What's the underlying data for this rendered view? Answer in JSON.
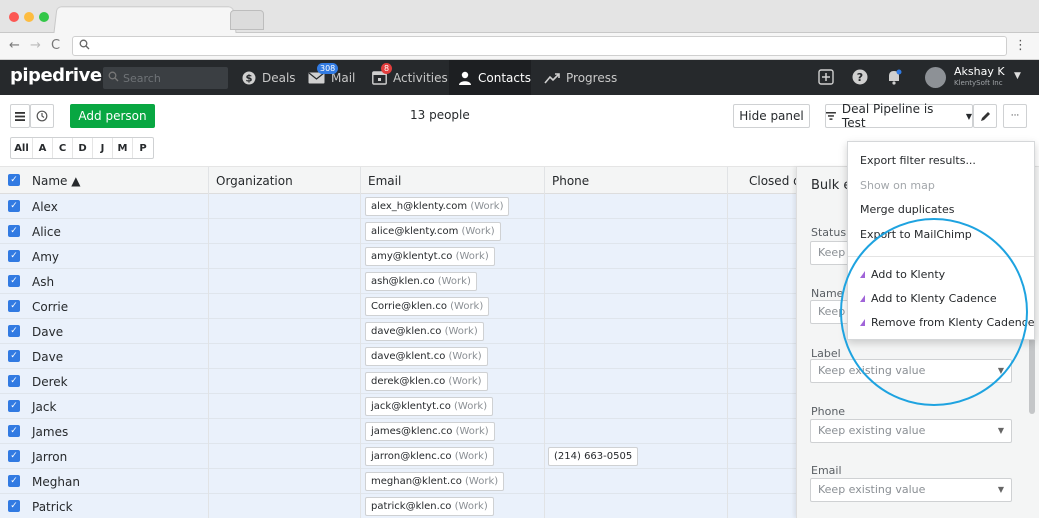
{
  "browser": {
    "nav_back": "←",
    "nav_forward": "→",
    "nav_reload": "C",
    "url_icon": "search-icon",
    "menu": "⋮"
  },
  "header": {
    "logo": "pipedrive",
    "search_placeholder": "Search",
    "nav": [
      {
        "label": "Deals",
        "icon": "dollar-icon"
      },
      {
        "label": "Mail",
        "icon": "mail-icon",
        "badge": "308"
      },
      {
        "label": "Activities",
        "icon": "calendar-icon",
        "badge": "8"
      },
      {
        "label": "Contacts",
        "icon": "person-icon"
      },
      {
        "label": "Progress",
        "icon": "trend-icon"
      }
    ],
    "user_name": "Akshay K",
    "user_org": "KlentySoft Inc"
  },
  "toolbar": {
    "add_person": "Add person",
    "count": "13 people",
    "hide_panel": "Hide panel",
    "filter": "Deal Pipeline is Test",
    "more": "···",
    "letters": [
      "All",
      "A",
      "C",
      "D",
      "J",
      "M",
      "P"
    ]
  },
  "table": {
    "columns": [
      "Name ▲",
      "Organization",
      "Email",
      "Phone",
      "Closed de"
    ],
    "rows": [
      {
        "name": "Alex",
        "email": "alex_h@klenty.com",
        "email_label": "(Work)",
        "phone": ""
      },
      {
        "name": "Alice",
        "email": "alice@klenty.com",
        "email_label": "(Work)",
        "phone": ""
      },
      {
        "name": "Amy",
        "email": "amy@klentyt.co",
        "email_label": "(Work)",
        "phone": ""
      },
      {
        "name": "Ash",
        "email": "ash@klen.co",
        "email_label": "(Work)",
        "phone": ""
      },
      {
        "name": "Corrie",
        "email": "Corrie@klen.co",
        "email_label": "(Work)",
        "phone": ""
      },
      {
        "name": "Dave",
        "email": "dave@klen.co",
        "email_label": "(Work)",
        "phone": ""
      },
      {
        "name": "Dave",
        "email": "dave@klent.co",
        "email_label": "(Work)",
        "phone": ""
      },
      {
        "name": "Derek",
        "email": "derek@klen.co",
        "email_label": "(Work)",
        "phone": ""
      },
      {
        "name": "Jack",
        "email": "jack@klentyt.co",
        "email_label": "(Work)",
        "phone": ""
      },
      {
        "name": "James",
        "email": "james@klenc.co",
        "email_label": "(Work)",
        "phone": ""
      },
      {
        "name": "Jarron",
        "email": "jarron@klenc.co",
        "email_label": "(Work)",
        "phone": "(214) 663-0505"
      },
      {
        "name": "Meghan",
        "email": "meghan@klent.co",
        "email_label": "(Work)",
        "phone": ""
      },
      {
        "name": "Patrick",
        "email": "patrick@klen.co",
        "email_label": "(Work)",
        "phone": ""
      }
    ]
  },
  "panel": {
    "title": "Bulk ed",
    "fields": [
      {
        "label": "Status",
        "value": "Keep e"
      },
      {
        "label": "Name",
        "value": "Keep"
      },
      {
        "label": "Label",
        "value": "Keep existing value"
      },
      {
        "label": "Phone",
        "value": "Keep existing value"
      },
      {
        "label": "Email",
        "value": "Keep existing value"
      }
    ]
  },
  "menu": {
    "items": [
      {
        "label": "Export filter results...",
        "disabled": false
      },
      {
        "label": "Show on map",
        "disabled": true
      },
      {
        "label": "Merge duplicates",
        "disabled": false
      },
      {
        "label": "Export to MailChimp",
        "disabled": false
      }
    ],
    "klenty_items": [
      {
        "label": "Add to Klenty"
      },
      {
        "label": "Add to Klenty Cadence"
      },
      {
        "label": "Remove from Klenty Cadence"
      }
    ]
  },
  "colors": {
    "accent_green": "#08a742",
    "header_bg": "#26292c",
    "check_blue": "#317ae2",
    "highlight_circle": "#1ea3e0",
    "klenty_purple": "#a064d8"
  }
}
